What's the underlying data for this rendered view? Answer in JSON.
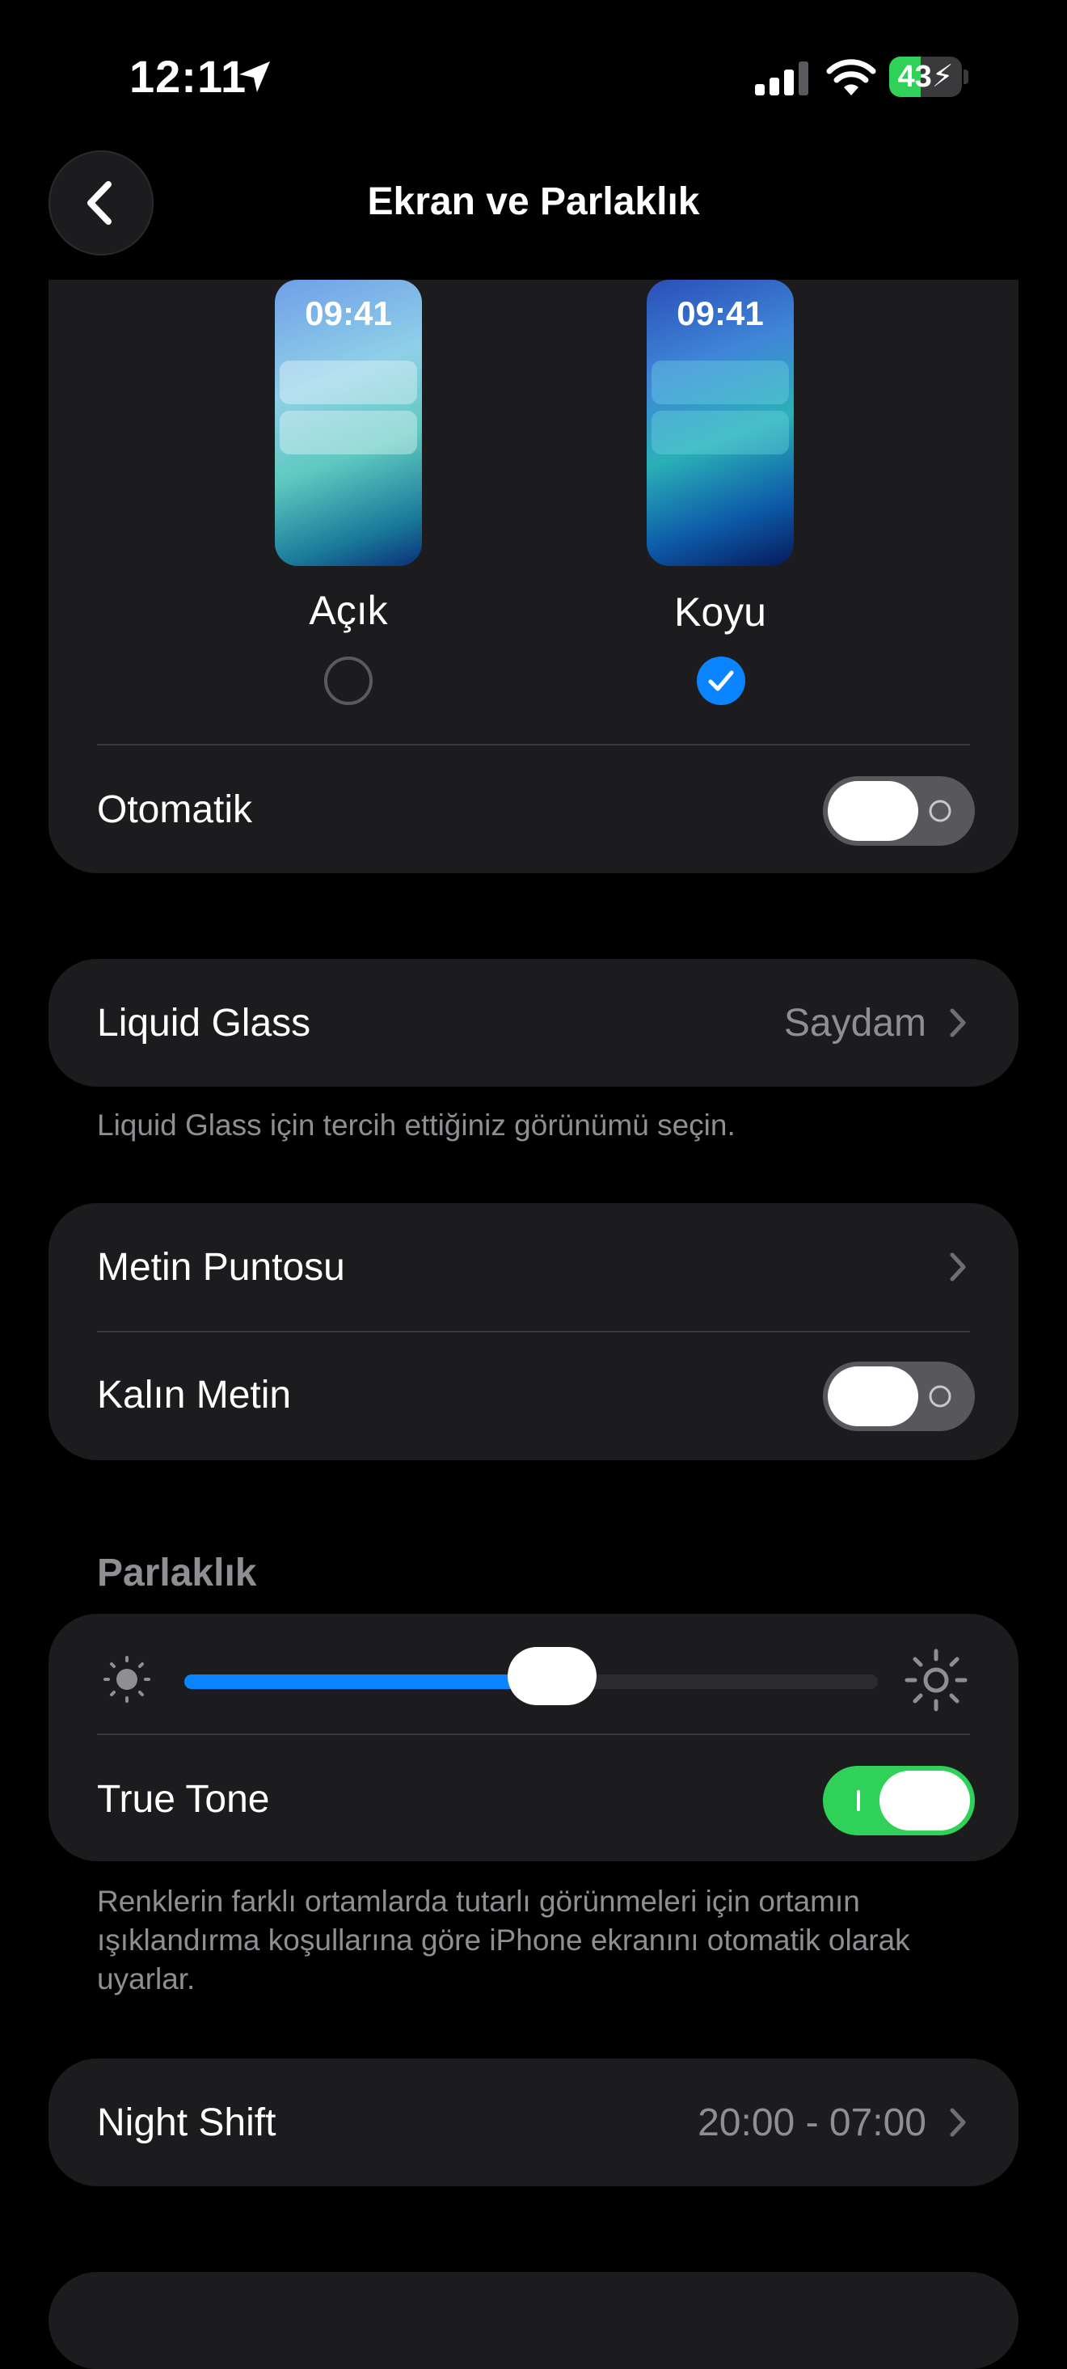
{
  "status_bar": {
    "time": "12:11",
    "battery": "43",
    "battery_level": 0.43
  },
  "nav": {
    "title": "Ekran ve Parlaklık",
    "back_icon": "chevron-left-icon"
  },
  "appearance": {
    "preview_time": "09:41",
    "light_label": "Açık",
    "dark_label": "Koyu",
    "selected": "dark",
    "automatic_label": "Otomatik",
    "automatic_on": false
  },
  "liquid_glass": {
    "label": "Liquid Glass",
    "value": "Saydam",
    "footnote": "Liquid Glass için tercih ettiğiniz görünümü seçin."
  },
  "text": {
    "text_size_label": "Metin Puntosu",
    "bold_text_label": "Kalın Metin",
    "bold_text_on": false
  },
  "brightness": {
    "header": "Parlaklık",
    "level": 0.53,
    "true_tone_label": "True Tone",
    "true_tone_on": true,
    "footnote": "Renklerin farklı ortamlarda tutarlı görünmeleri için ortamın ışıklandırma koşullarına göre iPhone ekranını otomatik olarak uyarlar."
  },
  "night_shift": {
    "label": "Night Shift",
    "value": "20:00 - 07:00"
  },
  "colors": {
    "accent": "#0a84ff",
    "toggle_on": "#30d158",
    "card": "#1c1c1e",
    "secondary_text": "#8e8e93"
  }
}
